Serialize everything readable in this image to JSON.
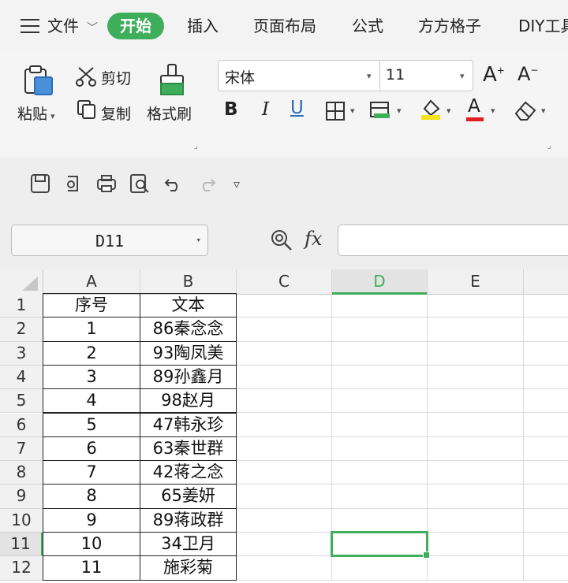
{
  "menu": {
    "file": "文件",
    "tabs": [
      "开始",
      "插入",
      "页面布局",
      "公式",
      "方方格子",
      "DIY工具"
    ]
  },
  "ribbon": {
    "paste": "粘贴",
    "cut": "剪切",
    "copy": "复制",
    "format_painter": "格式刷",
    "font_name": "宋体",
    "font_size": "11",
    "bold": "B",
    "italic": "I",
    "underline": "U",
    "font_color_label": "A",
    "grow_font": "A",
    "shrink_font": "A",
    "accent_green": "#3fae5b",
    "highlight_yellow": "#f5e21b",
    "font_red": "#e02020"
  },
  "formula_bar": {
    "cell_ref": "D11",
    "fx": "fx",
    "formula": ""
  },
  "sheet": {
    "columns": [
      "A",
      "B",
      "C",
      "D",
      "E"
    ],
    "row_numbers": [
      "1",
      "2",
      "3",
      "4",
      "5",
      "6",
      "7",
      "8",
      "9",
      "10",
      "11",
      "12"
    ],
    "rows": [
      [
        "序号",
        "文本"
      ],
      [
        "1",
        "86秦念念"
      ],
      [
        "2",
        "93陶凤美"
      ],
      [
        "3",
        "89孙鑫月"
      ],
      [
        "4",
        "98赵月"
      ],
      [
        "5",
        "47韩永珍"
      ],
      [
        "6",
        "63秦世群"
      ],
      [
        "7",
        "42蒋之念"
      ],
      [
        "8",
        "65姜妍"
      ],
      [
        "9",
        "89蒋政群"
      ],
      [
        "10",
        "34卫月"
      ],
      [
        "11",
        "施彩菊"
      ]
    ],
    "selected_column": "D",
    "selected_row": "11",
    "selection_color": "#3fae5b"
  }
}
